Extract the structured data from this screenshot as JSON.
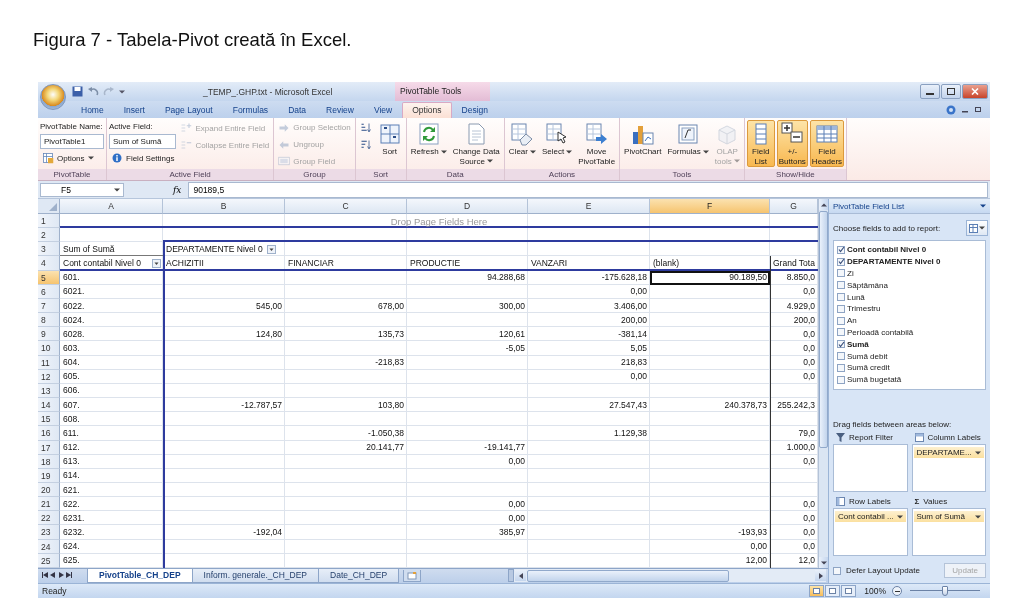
{
  "caption": "Figura 7 - Tabela-Pivot creată în Excel.",
  "window": {
    "title": "_TEMP_.GHP.txt - Microsoft Excel",
    "context_title": "PivotTable Tools"
  },
  "tabs": [
    {
      "label": "Home",
      "selected": false
    },
    {
      "label": "Insert",
      "selected": false
    },
    {
      "label": "Page Layout",
      "selected": false
    },
    {
      "label": "Formulas",
      "selected": false
    },
    {
      "label": "Data",
      "selected": false
    },
    {
      "label": "Review",
      "selected": false
    },
    {
      "label": "View",
      "selected": false
    },
    {
      "label": "Options",
      "selected": true
    },
    {
      "label": "Design",
      "selected": false
    }
  ],
  "ribbon": [
    {
      "label": "PivotTable",
      "columns": [
        [
          {
            "kind": "label",
            "text": "PivotTable Name:"
          },
          {
            "kind": "field",
            "value": "PivotTable1"
          },
          {
            "kind": "small",
            "label": "Options",
            "dropdown": true,
            "disabled": false
          }
        ]
      ]
    },
    {
      "label": "Active Field",
      "columns": [
        [
          {
            "kind": "label",
            "text": "Active Field:"
          },
          {
            "kind": "field",
            "value": "Sum of Sumă"
          },
          {
            "kind": "small",
            "label": "Field Settings",
            "dropdown": false,
            "disabled": false
          }
        ],
        [
          {
            "kind": "small",
            "label": "Expand Entire Field",
            "dropdown": false,
            "disabled": true
          },
          {
            "kind": "small",
            "label": "Collapse Entire Field",
            "dropdown": false,
            "disabled": true
          }
        ]
      ]
    },
    {
      "label": "Group",
      "columns": [
        [
          {
            "kind": "small",
            "label": "Group Selection",
            "dropdown": false,
            "disabled": true
          },
          {
            "kind": "small",
            "label": "Ungroup",
            "dropdown": false,
            "disabled": true
          },
          {
            "kind": "small",
            "label": "Group Field",
            "dropdown": false,
            "disabled": true
          }
        ]
      ]
    },
    {
      "label": "Sort",
      "columns": [
        [
          {
            "kind": "small",
            "dropdown": false,
            "disabled": false
          },
          {
            "kind": "small",
            "dropdown": false,
            "disabled": false
          }
        ],
        [
          {
            "kind": "large",
            "label": "Sort",
            "dropdown": false,
            "disabled": false,
            "on": false
          }
        ]
      ]
    },
    {
      "label": "Data",
      "columns": [
        [
          {
            "kind": "large",
            "label": "Refresh",
            "dropdown": true,
            "disabled": false,
            "on": false
          }
        ],
        [
          {
            "kind": "large",
            "label": "Change Data\nSource",
            "dropdown": true,
            "disabled": false,
            "on": false
          }
        ]
      ]
    },
    {
      "label": "Actions",
      "columns": [
        [
          {
            "kind": "large",
            "label": "Clear",
            "dropdown": true,
            "disabled": false,
            "on": false
          }
        ],
        [
          {
            "kind": "large",
            "label": "Select",
            "dropdown": true,
            "disabled": false,
            "on": false
          }
        ],
        [
          {
            "kind": "large",
            "label": "Move\nPivotTable",
            "dropdown": false,
            "disabled": false,
            "on": false
          }
        ]
      ]
    },
    {
      "label": "Tools",
      "columns": [
        [
          {
            "kind": "large",
            "label": "PivotChart",
            "dropdown": false,
            "disabled": false,
            "on": false
          }
        ],
        [
          {
            "kind": "large",
            "label": "Formulas",
            "dropdown": true,
            "disabled": false,
            "on": false
          }
        ],
        [
          {
            "kind": "large",
            "label": "OLAP\ntools",
            "dropdown": true,
            "disabled": true,
            "on": false
          }
        ]
      ]
    },
    {
      "label": "Show/Hide",
      "columns": [
        [
          {
            "kind": "large",
            "label": "Field\nList",
            "dropdown": false,
            "disabled": false,
            "on": true
          }
        ],
        [
          {
            "kind": "large",
            "label": "+/-\nButtons",
            "dropdown": false,
            "disabled": false,
            "on": true
          }
        ],
        [
          {
            "kind": "large",
            "label": "Field\nHeaders",
            "dropdown": false,
            "disabled": false,
            "on": true
          }
        ]
      ]
    }
  ],
  "formula_bar": {
    "name_box": "F5",
    "function_symbol": "fx",
    "value": "90189,5"
  },
  "sheet": {
    "columns": [
      {
        "label": "A",
        "selected": false
      },
      {
        "label": "B",
        "selected": false
      },
      {
        "label": "C",
        "selected": false
      },
      {
        "label": "D",
        "selected": false
      },
      {
        "label": "E",
        "selected": false
      },
      {
        "label": "F",
        "selected": true
      },
      {
        "label": "G",
        "selected": false
      }
    ],
    "rows": [
      {
        "number": "1",
        "kind": "drop-zone",
        "selected": false,
        "text": "Drop Page Fields Here"
      },
      {
        "number": "2",
        "kind": "blank",
        "selected": false
      },
      {
        "number": "3",
        "kind": "header",
        "selected": false,
        "cells": {
          "A": {
            "text": "Sum of Sumă",
            "dropdown": false
          },
          "B": {
            "text": "DEPARTAMENTE Nivel 0",
            "dropdown": true
          }
        }
      },
      {
        "number": "4",
        "kind": "header",
        "selected": false,
        "cells": {
          "A": {
            "text": "Cont contabil Nivel 0",
            "dropdown": true
          },
          "B": {
            "text": "ACHIZITII",
            "dropdown": false
          },
          "C": {
            "text": "FINANCIAR",
            "dropdown": false
          },
          "D": {
            "text": "PRODUCTIE",
            "dropdown": false
          },
          "E": {
            "text": "VANZARI",
            "dropdown": false
          },
          "F": {
            "text": "(blank)",
            "dropdown": false
          },
          "G": {
            "text": "Grand Tota",
            "dropdown": false
          }
        }
      },
      {
        "number": "5",
        "kind": "data",
        "selected": true,
        "cells": {
          "A": "601.",
          "D": "94.288,68",
          "E": "-175.628,18",
          "F": "90.189,50",
          "G": "8.850,0"
        }
      },
      {
        "number": "6",
        "kind": "data",
        "selected": false,
        "cells": {
          "A": "6021.",
          "E": "0,00",
          "G": "0,0"
        }
      },
      {
        "number": "7",
        "kind": "data",
        "selected": false,
        "cells": {
          "A": "6022.",
          "B": "545,00",
          "C": "678,00",
          "D": "300,00",
          "E": "3.406,00",
          "G": "4.929,0"
        }
      },
      {
        "number": "8",
        "kind": "data",
        "selected": false,
        "cells": {
          "A": "6024.",
          "E": "200,00",
          "G": "200,0"
        }
      },
      {
        "number": "9",
        "kind": "data",
        "selected": false,
        "cells": {
          "A": "6028.",
          "B": "124,80",
          "C": "135,73",
          "D": "120,61",
          "E": "-381,14",
          "G": "0,0"
        }
      },
      {
        "number": "10",
        "kind": "data",
        "selected": false,
        "cells": {
          "A": "603.",
          "D": "-5,05",
          "E": "5,05",
          "G": "0,0"
        }
      },
      {
        "number": "11",
        "kind": "data",
        "selected": false,
        "cells": {
          "A": "604.",
          "C": "-218,83",
          "E": "218,83",
          "G": "0,0"
        }
      },
      {
        "number": "12",
        "kind": "data",
        "selected": false,
        "cells": {
          "A": "605.",
          "E": "0,00",
          "G": "0,0"
        }
      },
      {
        "number": "13",
        "kind": "data",
        "selected": false,
        "cells": {
          "A": "606."
        }
      },
      {
        "number": "14",
        "kind": "data",
        "selected": false,
        "cells": {
          "A": "607.",
          "B": "-12.787,57",
          "C": "103,80",
          "E": "27.547,43",
          "F": "240.378,73",
          "G": "255.242,3"
        }
      },
      {
        "number": "15",
        "kind": "data",
        "selected": false,
        "cells": {
          "A": "608."
        }
      },
      {
        "number": "16",
        "kind": "data",
        "selected": false,
        "cells": {
          "A": "611.",
          "C": "-1.050,38",
          "E": "1.129,38",
          "G": "79,0"
        }
      },
      {
        "number": "17",
        "kind": "data",
        "selected": false,
        "cells": {
          "A": "612.",
          "C": "20.141,77",
          "D": "-19.141,77",
          "G": "1.000,0"
        }
      },
      {
        "number": "18",
        "kind": "data",
        "selected": false,
        "cells": {
          "A": "613.",
          "D": "0,00",
          "G": "0,0"
        }
      },
      {
        "number": "19",
        "kind": "data",
        "selected": false,
        "cells": {
          "A": "614."
        }
      },
      {
        "number": "20",
        "kind": "data",
        "selected": false,
        "cells": {
          "A": "621."
        }
      },
      {
        "number": "21",
        "kind": "data",
        "selected": false,
        "cells": {
          "A": "622.",
          "D": "0,00",
          "G": "0,0"
        }
      },
      {
        "number": "22",
        "kind": "data",
        "selected": false,
        "cells": {
          "A": "6231.",
          "D": "0,00",
          "G": "0,0"
        }
      },
      {
        "number": "23",
        "kind": "data",
        "selected": false,
        "cells": {
          "A": "6232.",
          "B": "-192,04",
          "D": "385,97",
          "F": "-193,93",
          "G": "0,0"
        }
      },
      {
        "number": "24",
        "kind": "data",
        "selected": false,
        "cells": {
          "A": "624.",
          "F": "0,00",
          "G": "0,0"
        }
      },
      {
        "number": "25",
        "kind": "data",
        "selected": false,
        "cells": {
          "A": "625.",
          "F": "12,00",
          "G": "12,0"
        }
      }
    ]
  },
  "sheet_tabs": [
    {
      "label": "PivotTable_CH_DEP",
      "selected": true
    },
    {
      "label": "Inform. generale._CH_DEP",
      "selected": false
    },
    {
      "label": "Date_CH_DEP",
      "selected": false
    }
  ],
  "field_list": {
    "title": "PivotTable Field List",
    "prompt": "Choose fields to add to report:",
    "fields": [
      {
        "label": "Cont contabil Nivel 0",
        "checked": true
      },
      {
        "label": "DEPARTAMENTE Nivel 0",
        "checked": true
      },
      {
        "label": "Zi",
        "checked": false
      },
      {
        "label": "Săptămâna",
        "checked": false
      },
      {
        "label": "Lună",
        "checked": false
      },
      {
        "label": "Trimestru",
        "checked": false
      },
      {
        "label": "An",
        "checked": false
      },
      {
        "label": "Perioadă contabilă",
        "checked": false
      },
      {
        "label": "Sumă",
        "checked": true
      },
      {
        "label": "Sumă debit",
        "checked": false
      },
      {
        "label": "Sumă credit",
        "checked": false
      },
      {
        "label": "Sumă bugetată",
        "checked": false
      }
    ],
    "areas_prompt": "Drag fields between areas below:",
    "areas": [
      {
        "kind": "filter",
        "label": "Report Filter"
      },
      {
        "kind": "columns",
        "label": "Column Labels",
        "items": [
          "DEPARTAME..."
        ]
      },
      {
        "kind": "rows",
        "label": "Row Labels",
        "items": [
          "Cont contabil ..."
        ]
      },
      {
        "kind": "values",
        "label": "Values",
        "symbol": "Σ",
        "items": [
          "Sum of Sumă"
        ]
      }
    ],
    "defer": {
      "label": "Defer Layout Update",
      "checked": false
    },
    "update_button": {
      "label": "Update",
      "disabled": true
    }
  },
  "status_bar": {
    "text": "Ready",
    "views": [
      {
        "selected": true
      },
      {
        "selected": false
      },
      {
        "selected": false
      }
    ],
    "zoom": "100%",
    "zoom_slider": {
      "level": 0.5
    }
  }
}
